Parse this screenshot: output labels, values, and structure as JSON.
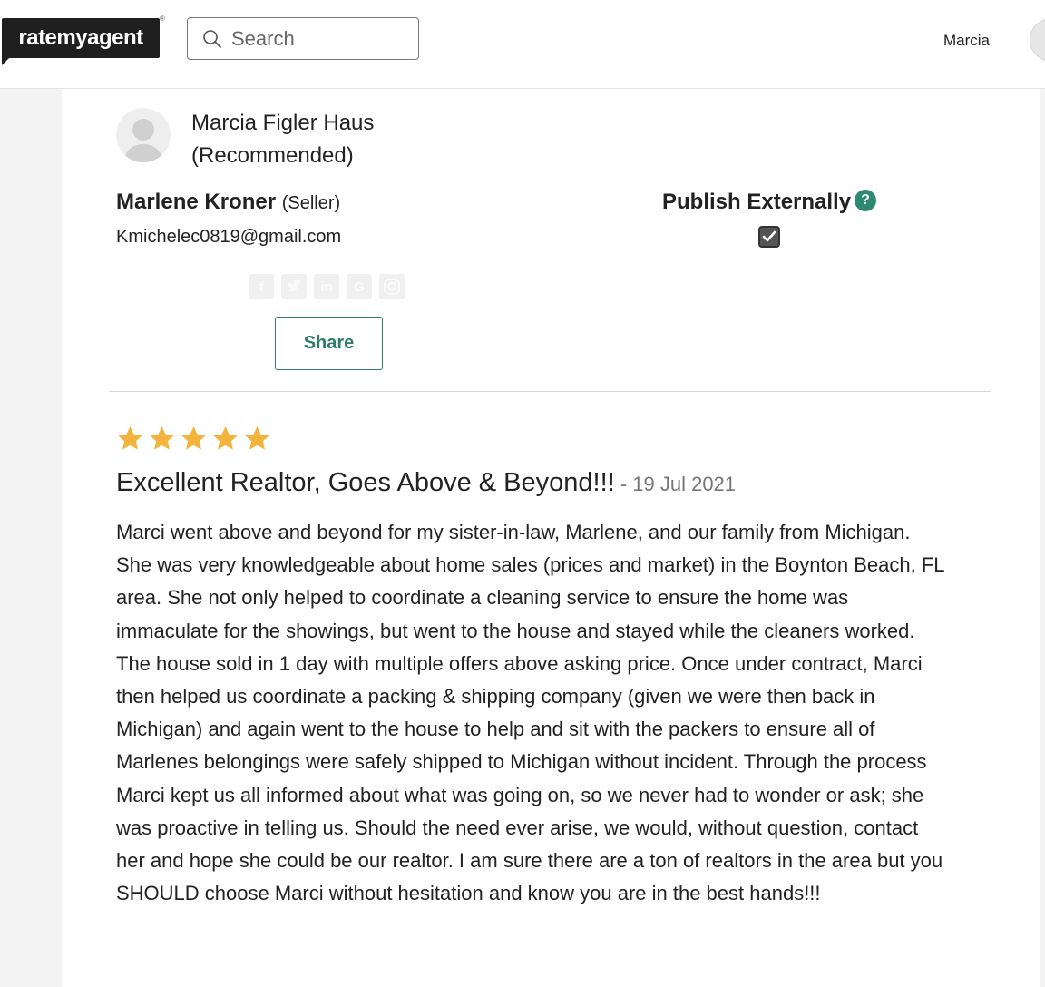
{
  "header": {
    "logo_text": "ratemyagent",
    "logo_mark": "®",
    "search_placeholder": "Search",
    "user_name": "Marcia"
  },
  "agent": {
    "name": "Marcia Figler Haus",
    "status": "(Recommended)"
  },
  "reviewer": {
    "name": "Marlene Kroner",
    "role": "(Seller)",
    "email": "Kmichelec0819@gmail.com"
  },
  "publish": {
    "label": "Publish Externally",
    "help": "?",
    "checked": true
  },
  "social_icons": [
    "f",
    "t",
    "in",
    "G",
    "ig"
  ],
  "share_label": "Share",
  "review": {
    "rating": 5,
    "rating_max": 5,
    "title": "Excellent Realtor, Goes Above & Beyond!!!",
    "date": " - 19 Jul 2021",
    "body": "Marci went above and beyond for my sister-in-law, Marlene, and our family from Michigan. She was very knowledgeable about home sales (prices and market) in the Boynton Beach, FL area. She not only helped to coordinate a cleaning service to ensure the home was immaculate for the showings, but went to the house and stayed while the cleaners worked. The house sold in 1 day with multiple offers above asking price. Once under contract, Marci then helped us coordinate a packing & shipping company (given we were then back in Michigan) and again went to the house to help and sit with the packers to ensure all of Marlenes belongings were safely shipped to Michigan without incident. Through the process Marci kept us all informed about what was going on, so we never had to wonder or ask; she was proactive in telling us. Should the need ever arise, we would, without question, contact her and hope she could be our realtor. I am sure there are a ton of realtors in the area but you SHOULD choose Marci without hesitation and know you are in the best hands!!!"
  },
  "colors": {
    "accent": "#2d7d68",
    "star": "#f2b43c",
    "logo_bg": "#1f1f1f"
  }
}
